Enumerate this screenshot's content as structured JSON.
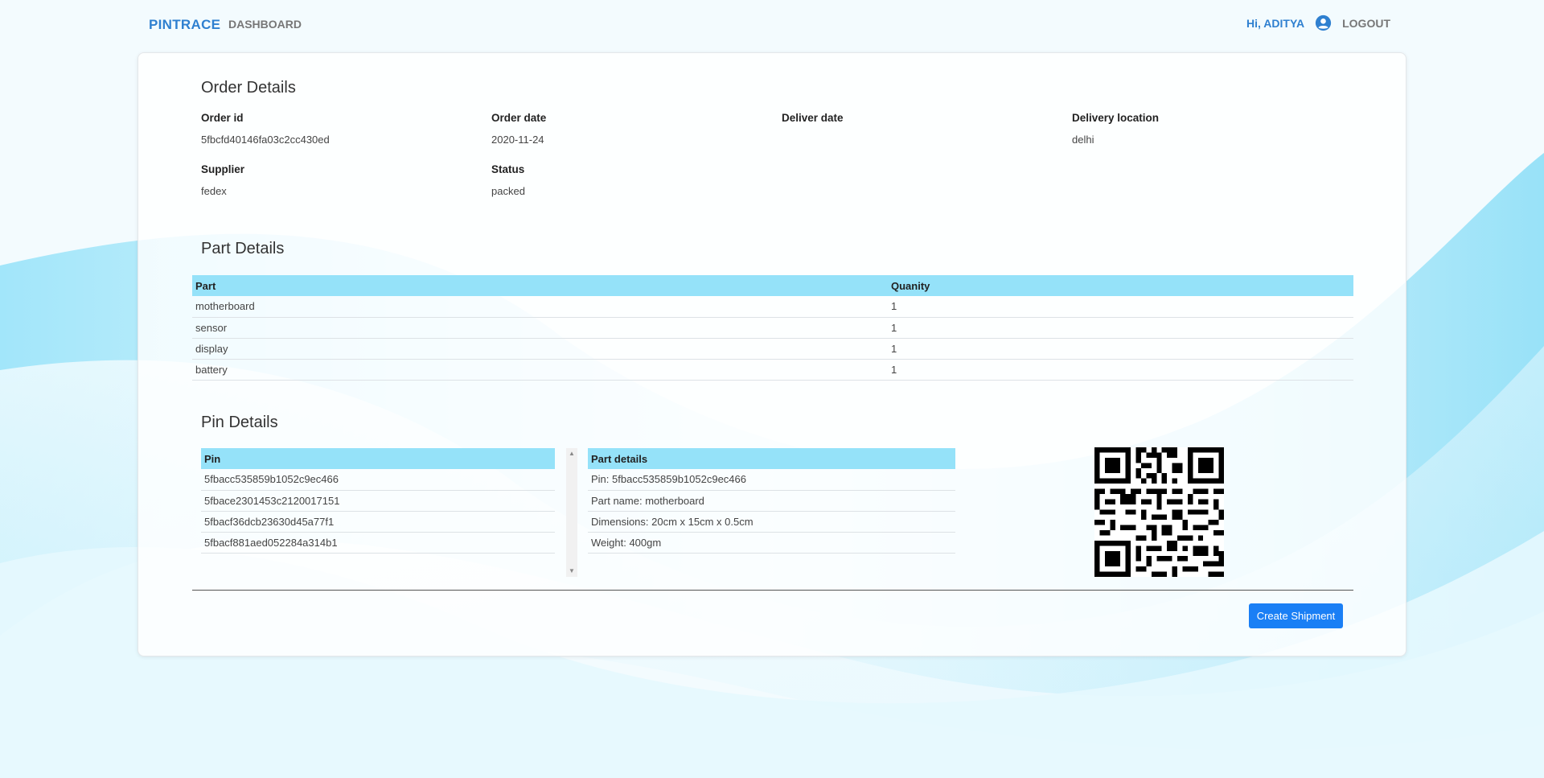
{
  "nav": {
    "brand": "PINTRACE",
    "dashboard": "DASHBOARD",
    "greeting": "Hi, ADITYA",
    "logout": "LOGOUT"
  },
  "order": {
    "title": "Order Details",
    "fields": [
      {
        "label": "Order id",
        "value": "5fbcfd40146fa03c2cc430ed"
      },
      {
        "label": "Order date",
        "value": "2020-11-24"
      },
      {
        "label": "Deliver date",
        "value": ""
      },
      {
        "label": "Delivery location",
        "value": "delhi"
      },
      {
        "label": "Supplier",
        "value": "fedex"
      },
      {
        "label": "Status",
        "value": "packed"
      }
    ]
  },
  "parts": {
    "title": "Part Details",
    "headers": [
      "Part",
      "Quanity"
    ],
    "rows": [
      [
        "motherboard",
        "1"
      ],
      [
        "sensor",
        "1"
      ],
      [
        "display",
        "1"
      ],
      [
        "battery",
        "1"
      ]
    ]
  },
  "pins": {
    "title": "Pin Details",
    "list_header": "Pin",
    "list": [
      "5fbacc535859b1052c9ec466",
      "5fbace2301453c2120017151",
      "5fbacf36dcb23630d45a77f1",
      "5fbacf881aed052284a314b1"
    ],
    "details_header": "Part details",
    "details": [
      "Pin: 5fbacc535859b1052c9ec466",
      "Part name: motherboard",
      "Dimensions: 20cm x 15cm x 0.5cm",
      "Weight: 400gm"
    ]
  },
  "actions": {
    "create_shipment": "Create Shipment"
  },
  "colors": {
    "accent": "#1a7ff5",
    "brand": "#2f80d0",
    "table_header": "#95e2f9"
  }
}
